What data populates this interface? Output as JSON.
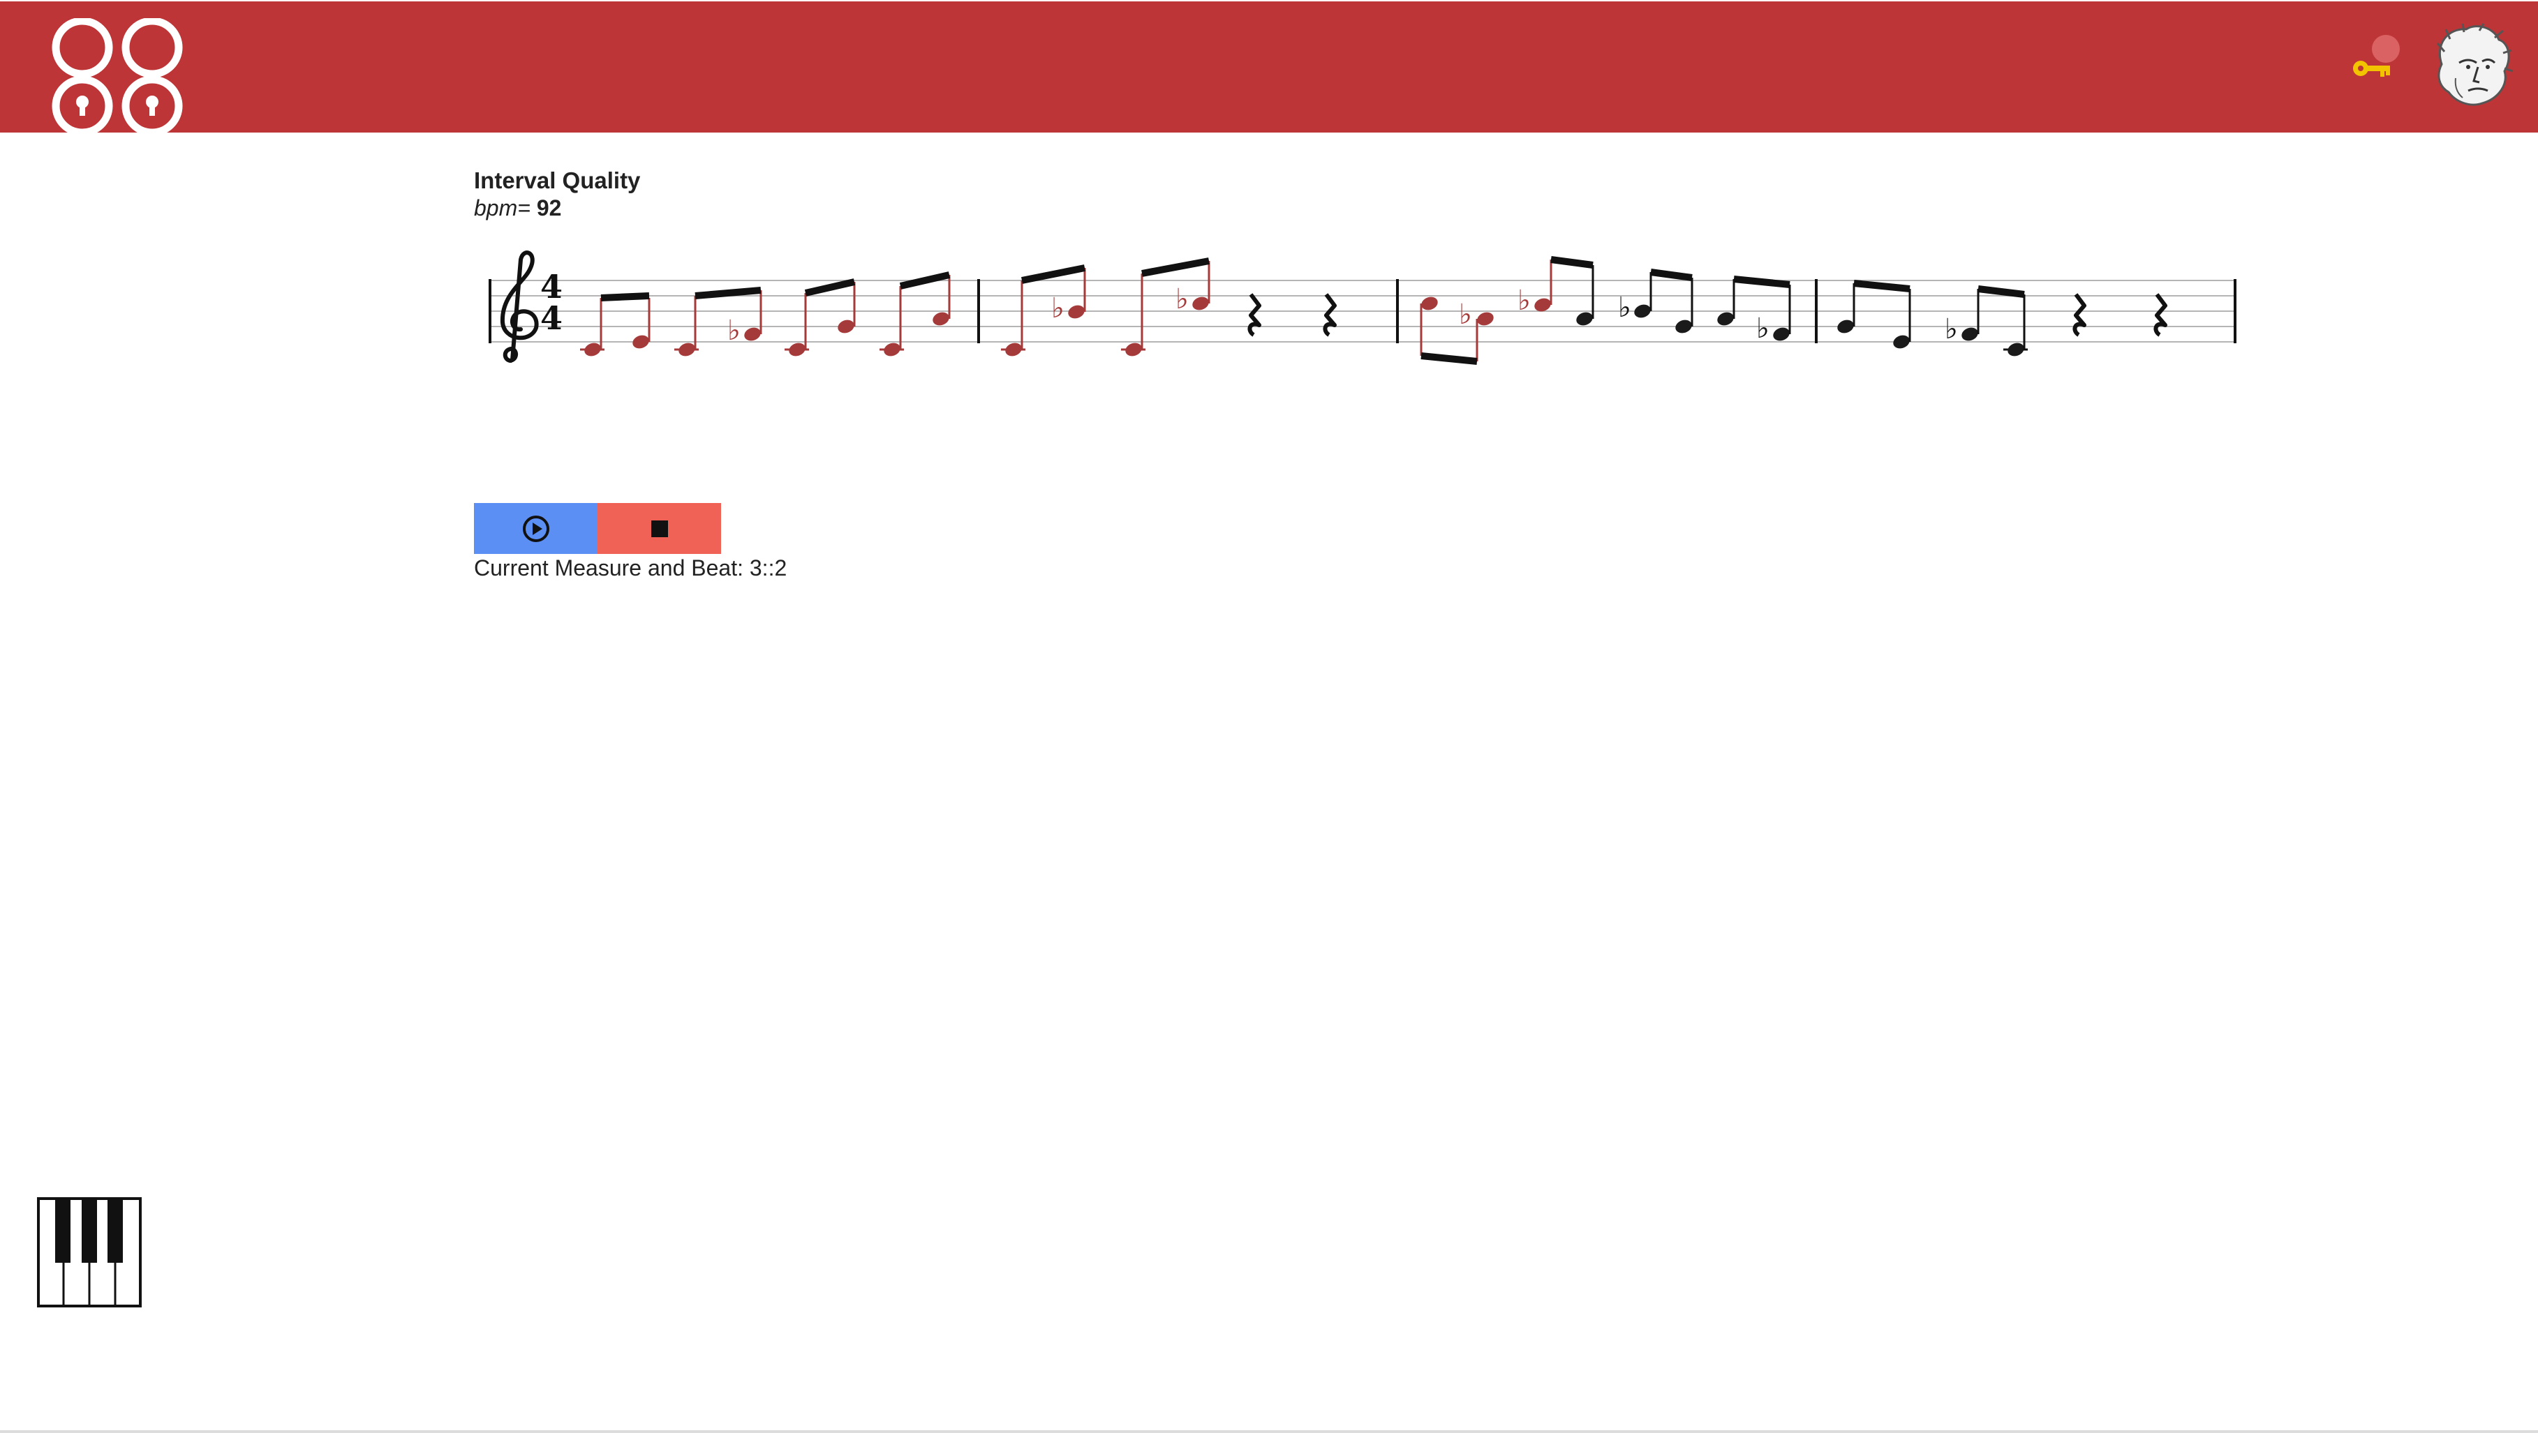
{
  "header": {
    "logo_icon": "88-keys-logo-icon",
    "key_icon": "key-icon",
    "avatar_icon": "beethoven-avatar-icon",
    "brand_color": "#bd3537"
  },
  "exercise": {
    "title": "Interval Quality",
    "tempo_label": "bpm",
    "tempo_eq": "=",
    "tempo_value": "92",
    "time_signature_top": "4",
    "time_signature_bottom": "4",
    "clef": "treble",
    "measures": 4
  },
  "player": {
    "play_icon": "play-circle-icon",
    "stop_icon": "stop-square-icon",
    "play_color": "#5b8ff4",
    "stop_color": "#f06255",
    "status_text": "Current Measure and Beat: 3::2"
  },
  "footer": {
    "piano_icon": "piano-keyboard-icon"
  }
}
